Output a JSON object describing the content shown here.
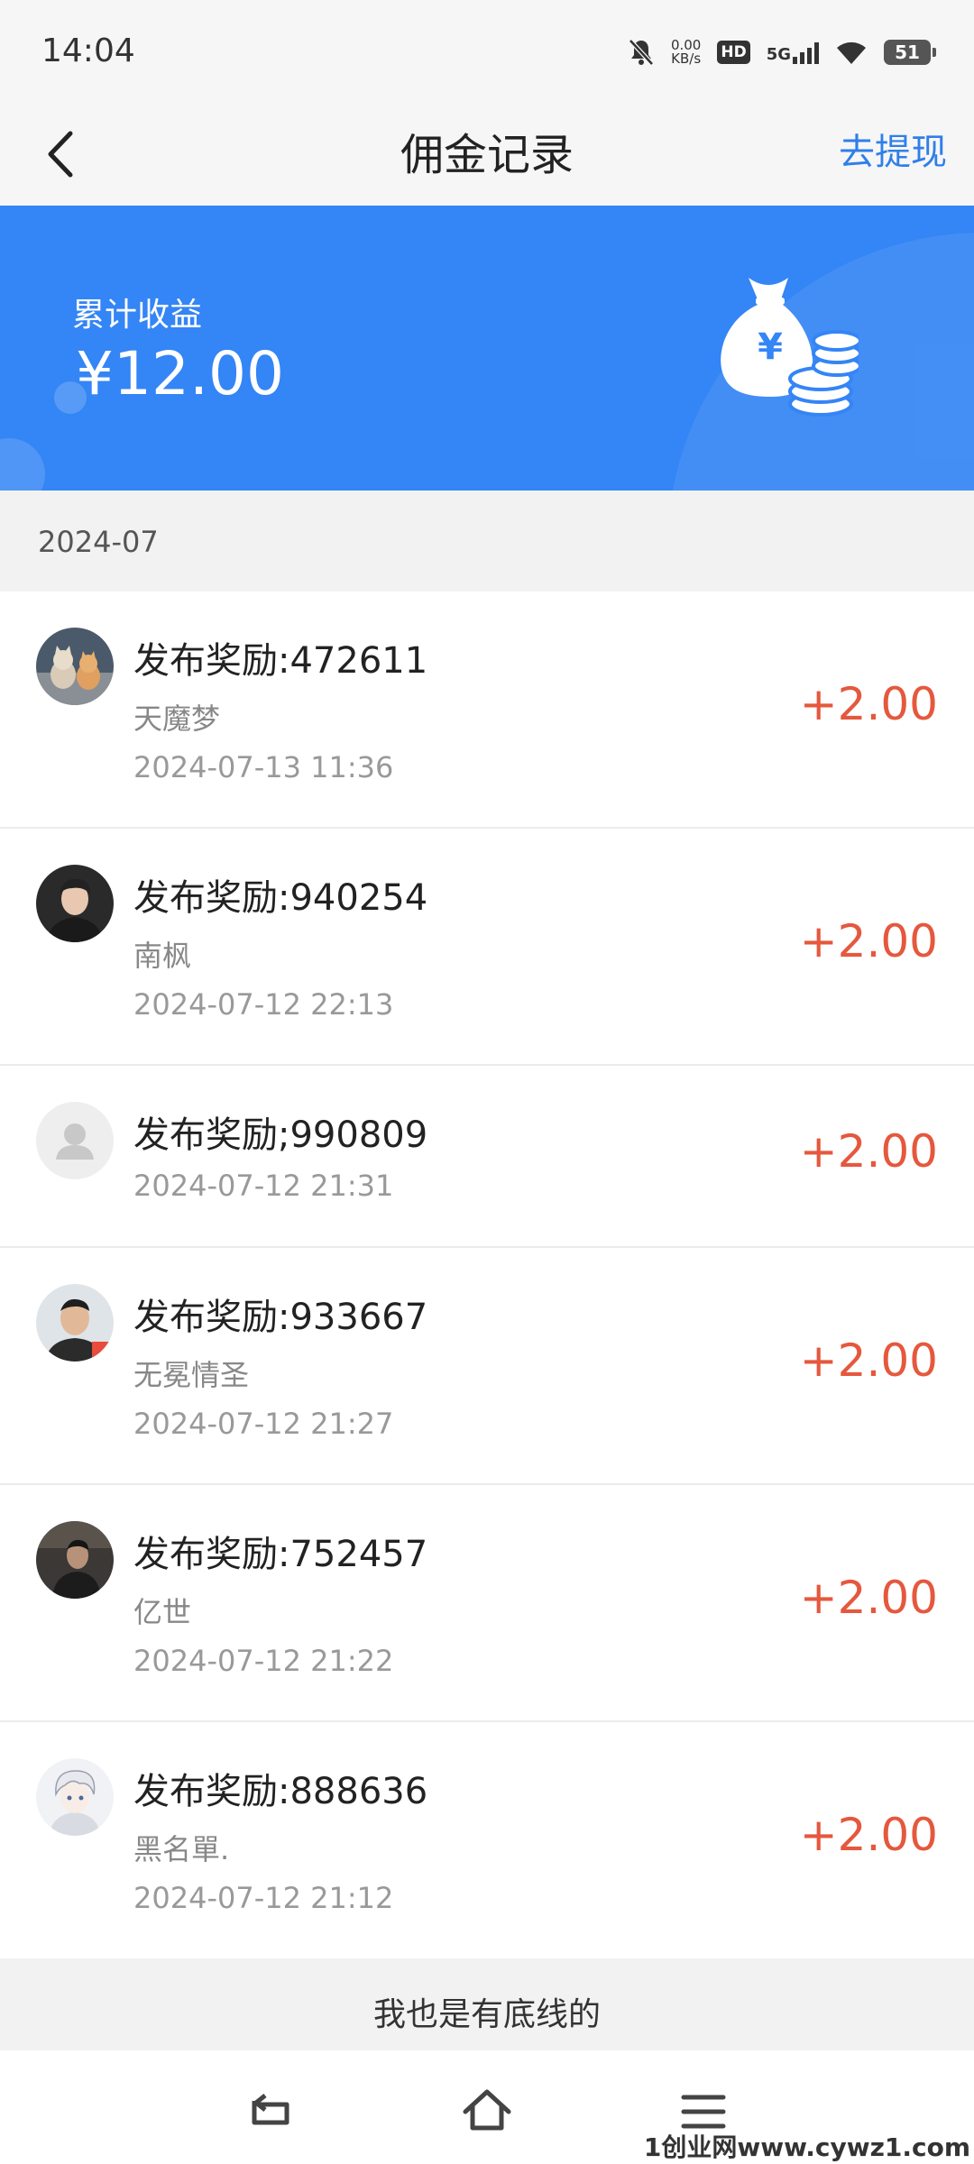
{
  "status_bar": {
    "time": "14:04",
    "net_speed_value": "0.00",
    "net_speed_unit": "KB/s",
    "hd": "HD",
    "network": "5G",
    "battery": "51"
  },
  "nav": {
    "title": "佣金记录",
    "withdraw_label": "去提现"
  },
  "banner": {
    "label": "累计收益",
    "amount": "¥12.00"
  },
  "month": "2024-07",
  "records": [
    {
      "title": "发布奖励:472611",
      "name": "天魔梦",
      "date": "2024-07-13 11:36",
      "amount": "+2.00",
      "avatar": "cats-avatar"
    },
    {
      "title": "发布奖励:940254",
      "name": "南枫",
      "date": "2024-07-12 22:13",
      "amount": "+2.00",
      "avatar": "man-avatar"
    },
    {
      "title": "发布奖励;990809",
      "name": "",
      "date": "2024-07-12 21:31",
      "amount": "+2.00",
      "avatar": "default-avatar"
    },
    {
      "title": "发布奖励:933667",
      "name": "无冕情圣",
      "date": "2024-07-12 21:27",
      "amount": "+2.00",
      "avatar": "man-avatar"
    },
    {
      "title": "发布奖励:752457",
      "name": "亿世",
      "date": "2024-07-12 21:22",
      "amount": "+2.00",
      "avatar": "dark-avatar"
    },
    {
      "title": "发布奖励:888636",
      "name": "黑名單.",
      "date": "2024-07-12 21:12",
      "amount": "+2.00",
      "avatar": "anime-avatar"
    }
  ],
  "footer_note": "我也是有底线的",
  "watermark": "1创业网www.cywz1.com",
  "colors": {
    "accent": "#2f7fe9",
    "banner": "#3485f5",
    "amount": "#e5583e"
  }
}
